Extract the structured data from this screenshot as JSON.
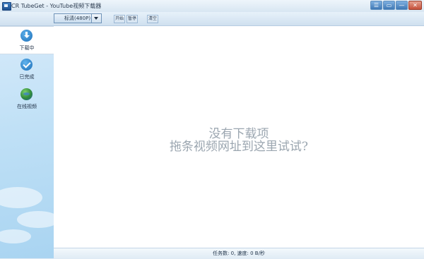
{
  "window": {
    "title": "CR TubeGet - YouTube视频下载器",
    "buttons": {
      "menu": "☰",
      "restore": "▭",
      "minimize": "—",
      "close": "✕"
    }
  },
  "toolbar": {
    "quality_select": "标清(480P)",
    "buttons": [
      "开始",
      "暂停",
      "清空"
    ]
  },
  "sidebar": {
    "items": [
      {
        "label": "下载中",
        "icon": "download-icon",
        "active": true
      },
      {
        "label": "已完成",
        "icon": "check-icon",
        "active": false
      },
      {
        "label": "在线视频",
        "icon": "globe-icon",
        "active": false
      }
    ]
  },
  "main": {
    "empty_line1": "没有下载项",
    "empty_line2": "拖条视频网址到这里试试?"
  },
  "statusbar": {
    "text": "任务数: 0, 速度: 0 B/秒"
  },
  "colors": {
    "accent": "#1c6fb9",
    "sidebar_bg": "#bfe0f6",
    "empty_text": "#9ba6b0"
  }
}
